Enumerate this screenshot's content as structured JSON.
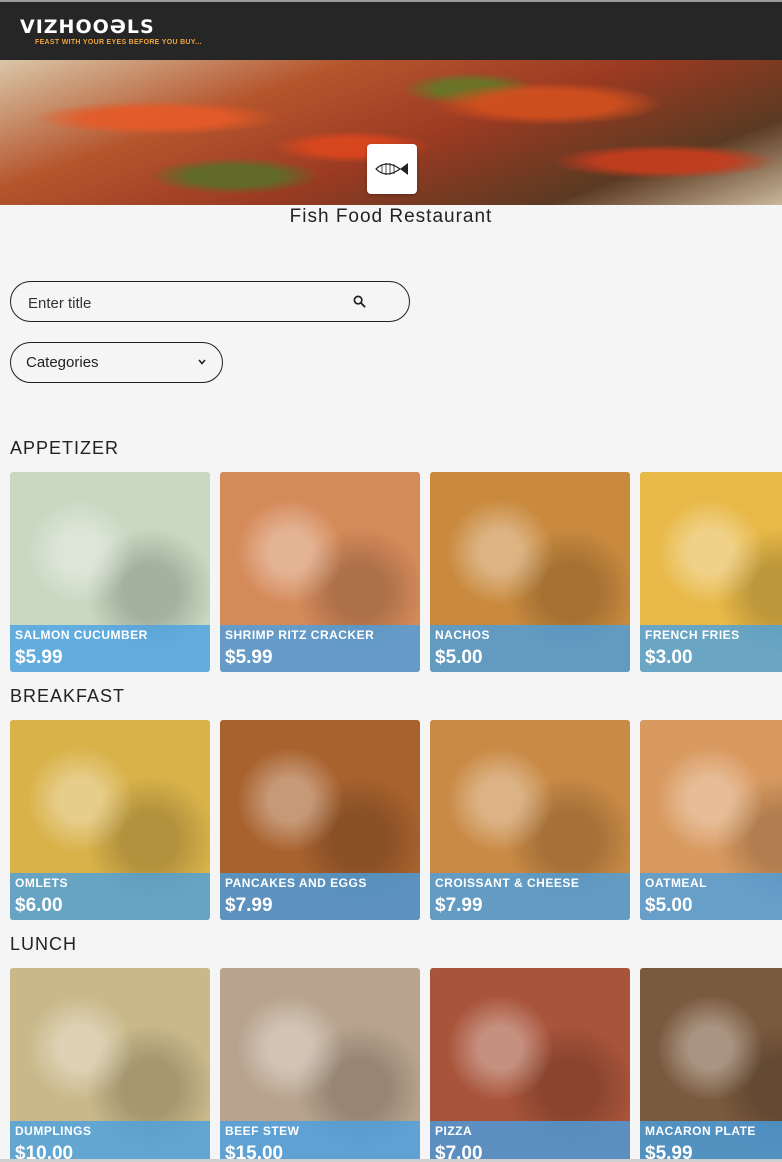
{
  "header": {
    "brand": "VIZHOOƏLS",
    "tagline": "FEAST WITH YOUR EYES BEFORE YOU BUY..."
  },
  "restaurant": {
    "name": "Fish Food Restaurant"
  },
  "search": {
    "placeholder": "Enter title",
    "icon": "search-icon"
  },
  "categories": {
    "label": "Categories",
    "icon": "chevron-down-icon"
  },
  "sections": [
    {
      "title": "APPETIZER",
      "items": [
        {
          "name": "SALMON CUCUMBER",
          "price": "$5.99",
          "color": "#c9d8c2"
        },
        {
          "name": "SHRIMP RITZ CRACKER",
          "price": "$5.99",
          "color": "#d58a5a"
        },
        {
          "name": "NACHOS",
          "price": "$5.00",
          "color": "#c98a3e"
        },
        {
          "name": "FRENCH FRIES",
          "price": "$3.00",
          "color": "#e8b948"
        }
      ]
    },
    {
      "title": "BREAKFAST",
      "items": [
        {
          "name": "OMLETS",
          "price": "$6.00",
          "color": "#d9b24a"
        },
        {
          "name": "PANCAKES AND EGGS",
          "price": "$7.99",
          "color": "#a8622e"
        },
        {
          "name": "CROISSANT & CHEESE",
          "price": "$7.99",
          "color": "#c98a45"
        },
        {
          "name": "OATMEAL",
          "price": "$5.00",
          "color": "#d99a60"
        }
      ]
    },
    {
      "title": "LUNCH",
      "items": [
        {
          "name": "DUMPLINGS",
          "price": "$10.00",
          "color": "#c9b98a"
        },
        {
          "name": "BEEF STEW",
          "price": "$15.00",
          "color": "#b8a48e"
        },
        {
          "name": "PIZZA",
          "price": "$7.00",
          "color": "#a8543a"
        },
        {
          "name": "MACARON PLATE",
          "price": "$5.99",
          "color": "#7a5a3e"
        }
      ]
    }
  ]
}
